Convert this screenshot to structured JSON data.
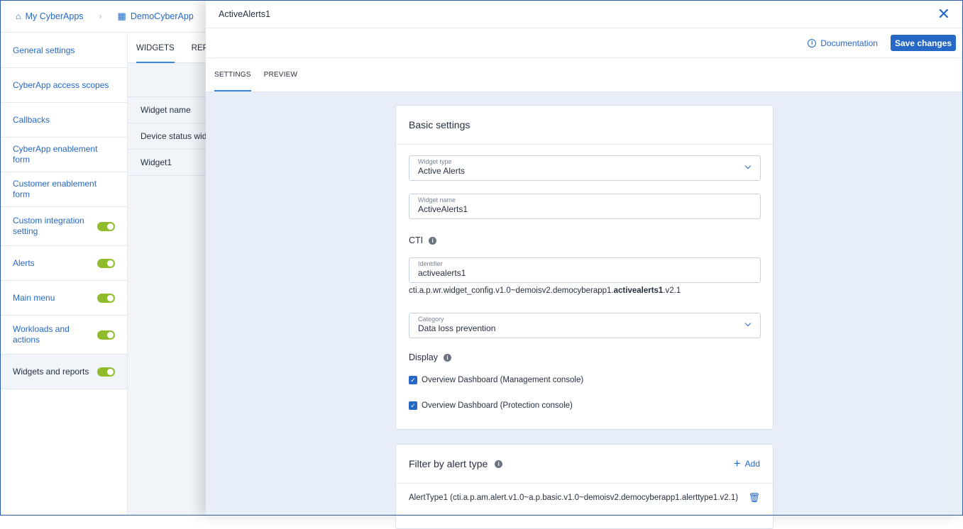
{
  "breadcrumb": {
    "items": [
      "My CyberApps",
      "DemoCyberApp"
    ]
  },
  "sidebar": {
    "items": [
      {
        "label": "General settings"
      },
      {
        "label": "CyberApp access scopes"
      },
      {
        "label": "Callbacks"
      },
      {
        "label": "CyberApp enablement form"
      },
      {
        "label": "Customer enablement form"
      },
      {
        "label": "Custom integration setting",
        "toggle": true
      },
      {
        "label": "Alerts",
        "toggle": true
      },
      {
        "label": "Main menu",
        "toggle": true
      },
      {
        "label": "Workloads and actions",
        "toggle": true
      },
      {
        "label": "Widgets and reports",
        "toggle": true,
        "active": true
      }
    ]
  },
  "middle": {
    "tabs": [
      "WIDGETS",
      "REPORTS"
    ],
    "column_header": "Widget name",
    "rows": [
      "Device status widget",
      "Widget1"
    ]
  },
  "panel": {
    "title": "ActiveAlerts1",
    "documentation_label": "Documentation",
    "save_label": "Save changes",
    "tabs": [
      "SETTINGS",
      "PREVIEW"
    ],
    "basic": {
      "title": "Basic settings",
      "widget_type": {
        "label": "Widget type",
        "value": "Active Alerts"
      },
      "widget_name": {
        "label": "Widget name",
        "value": "ActiveAlerts1"
      },
      "cti_label": "CTI",
      "identifier": {
        "label": "Identifier",
        "value": "activealerts1"
      },
      "cti_prefix": "cti.a.p.wr.widget_config.v1.0~demoisv2.democyberapp1.",
      "cti_bold": "activealerts1",
      "cti_suffix": ".v2.1",
      "category": {
        "label": "Category",
        "value": "Data loss prevention"
      },
      "display_label": "Display",
      "checkboxes": [
        {
          "label": "Overview Dashboard (Management console)",
          "checked": true
        },
        {
          "label": "Overview Dashboard (Protection console)",
          "checked": true
        }
      ]
    },
    "filter": {
      "title": "Filter by alert type",
      "add_label": "Add",
      "items": [
        "AlertType1 (cti.a.p.am.alert.v1.0~a.p.basic.v1.0~demoisv2.democyberapp1.alerttype1.v2.1)"
      ]
    }
  },
  "colors": {
    "accent": "#2668c5",
    "toggle_on": "#8fbc2b",
    "content_bg": "#e8eef8"
  }
}
